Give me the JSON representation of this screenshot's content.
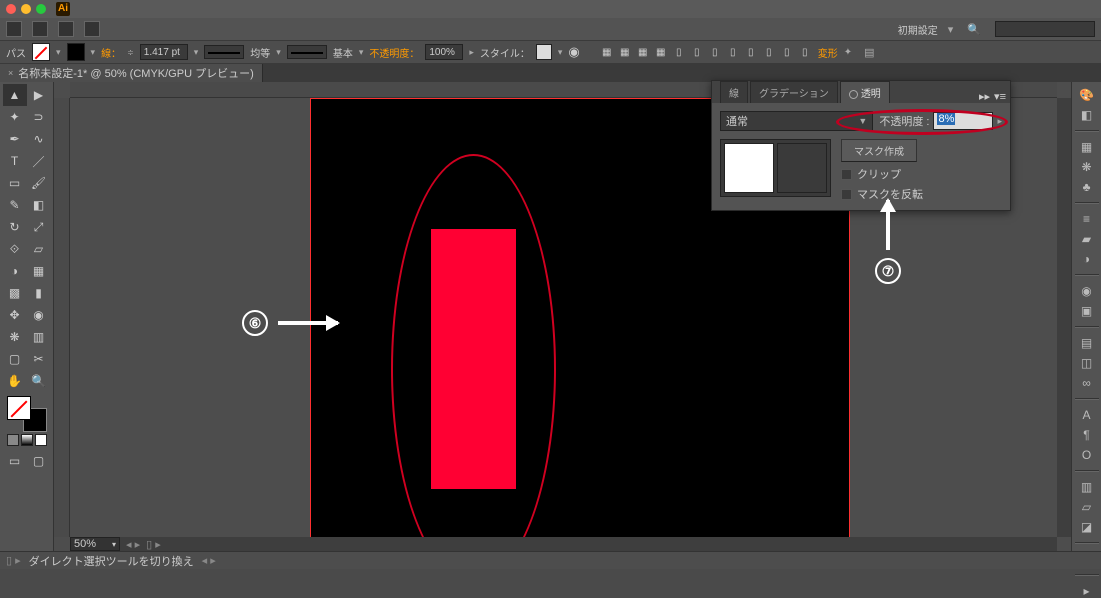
{
  "titlebar": {
    "app": "Ai"
  },
  "menubar": {
    "workspace": "初期設定"
  },
  "controlbar": {
    "leftlabel": "パス",
    "stroke_label": "線：",
    "stroke_weight": "1.417 pt",
    "uniform": "均等",
    "basic": "基本",
    "opacity_label": "不透明度：",
    "opacity_value": "100%",
    "style_label": "スタイル：",
    "transform": "変形"
  },
  "doctab": {
    "title": "名称未設定-1* @ 50% (CMYK/GPU プレビュー)"
  },
  "zoom": "50%",
  "statusbar": {
    "tool": "ダイレクト選択ツールを切り換え"
  },
  "panel": {
    "tab_stroke": "線",
    "tab_grad": "グラデーション",
    "tab_trans": "透明",
    "blend": "通常",
    "opacity_label": "不透明度 :",
    "opacity_value": "8%",
    "mask_btn": "マスク作成",
    "clip": "クリップ",
    "invert": "マスクを反転"
  },
  "annotations": {
    "six": "⑥",
    "seven": "⑦"
  },
  "rightpanel": {
    "A": "A",
    "t": "¶",
    "o": "O"
  }
}
